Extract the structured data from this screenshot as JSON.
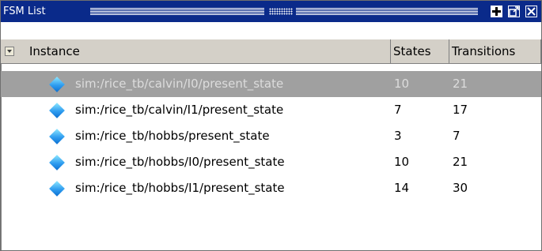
{
  "window": {
    "title": "FSM List",
    "buttons": {
      "add": "+",
      "undock": "⧉",
      "close": "✕"
    }
  },
  "columns": {
    "instance": "Instance",
    "states": "States",
    "transitions": "Transitions"
  },
  "rows": [
    {
      "instance": "sim:/rice_tb/calvin/I0/present_state",
      "states": "10",
      "transitions": "21",
      "selected": true
    },
    {
      "instance": "sim:/rice_tb/calvin/I1/present_state",
      "states": "7",
      "transitions": "17"
    },
    {
      "instance": "sim:/rice_tb/hobbs/present_state",
      "states": "3",
      "transitions": "7"
    },
    {
      "instance": "sim:/rice_tb/hobbs/I0/present_state",
      "states": "10",
      "transitions": "21"
    },
    {
      "instance": "sim:/rice_tb/hobbs/I1/present_state",
      "states": "14",
      "transitions": "30"
    }
  ],
  "icons": {
    "row": "fsm-diamond-icon",
    "sort": "sort-down-icon"
  },
  "colors": {
    "titlebar": "#0a2a8a",
    "selected_row": "#a0a0a0",
    "header_bg": "#d4d0c8",
    "icon": "#2f9df0"
  }
}
